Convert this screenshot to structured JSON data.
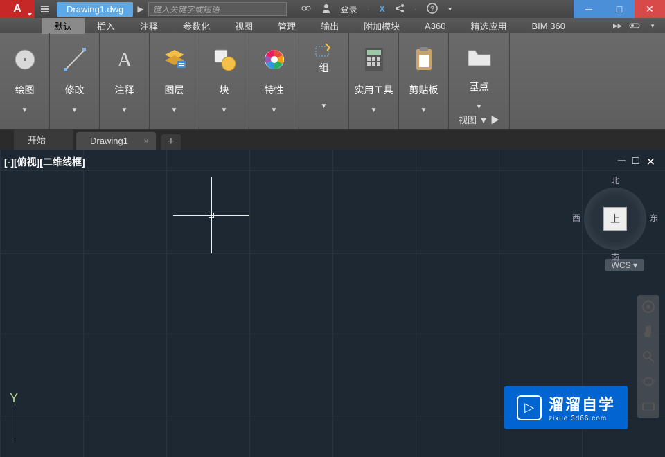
{
  "titlebar": {
    "app_symbol": "A",
    "doc_name": "Drawing1.dwg",
    "search_placeholder": "键入关键字或短语",
    "login_label": "登录"
  },
  "menubar": {
    "items": [
      "默认",
      "插入",
      "注释",
      "参数化",
      "视图",
      "管理",
      "输出",
      "附加模块",
      "A360",
      "精选应用",
      "BIM 360"
    ]
  },
  "ribbon": {
    "panels": [
      {
        "label": "绘图"
      },
      {
        "label": "修改"
      },
      {
        "label": "注释"
      },
      {
        "label": "图层"
      },
      {
        "label": "块"
      },
      {
        "label": "特性"
      },
      {
        "label": "组"
      },
      {
        "label": "实用工具"
      },
      {
        "label": "剪贴板"
      },
      {
        "label": "基点"
      }
    ],
    "footer_label": "视图"
  },
  "doc_tabs": {
    "start": "开始",
    "active": "Drawing1"
  },
  "canvas": {
    "view_label": "[-][俯视][二维线框]",
    "ucs_y": "Y",
    "viewcube": {
      "top": "上",
      "north": "北",
      "south": "南",
      "east": "东",
      "west": "西"
    },
    "wcs": "WCS"
  },
  "watermark": {
    "title": "溜溜自学",
    "sub": "zixue.3d66.com"
  }
}
